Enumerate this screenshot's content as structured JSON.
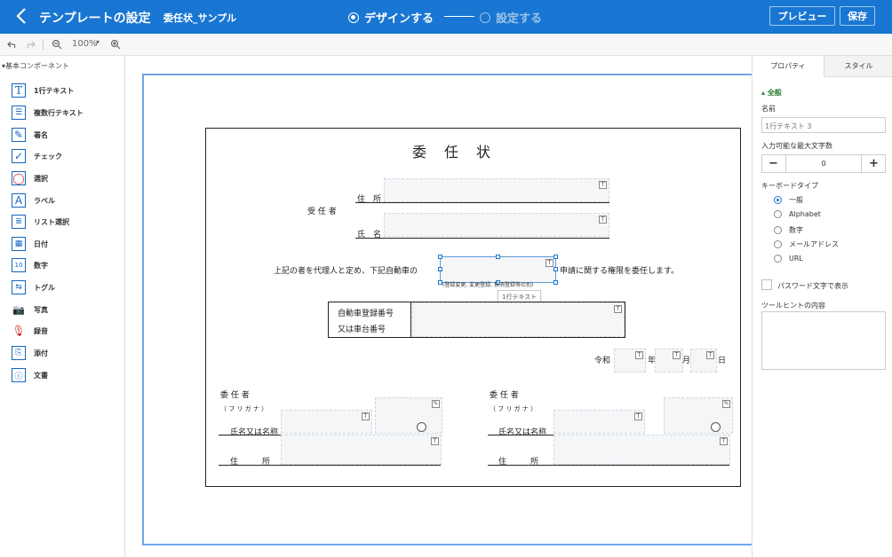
{
  "header": {
    "title": "テンプレートの設定",
    "doc_name": "委任状_サンプル",
    "step_design": "デザインする",
    "step_settings": "設定する",
    "preview_label": "プレビュー",
    "save_label": "保存"
  },
  "toolbar": {
    "zoom": "100%"
  },
  "left_panel": {
    "heading": "基本コンポーネント",
    "items": [
      {
        "label": "1行テキスト",
        "icon": "text-icon"
      },
      {
        "label": "複数行テキスト",
        "icon": "multiline-text-icon"
      },
      {
        "label": "署名",
        "icon": "signature-icon"
      },
      {
        "label": "チェック",
        "icon": "check-icon"
      },
      {
        "label": "選択",
        "icon": "select-icon"
      },
      {
        "label": "ラベル",
        "icon": "label-icon"
      },
      {
        "label": "リスト選択",
        "icon": "list-icon"
      },
      {
        "label": "日付",
        "icon": "calendar-icon"
      },
      {
        "label": "数字",
        "icon": "number-icon"
      },
      {
        "label": "トグル",
        "icon": "toggle-icon"
      },
      {
        "label": "写真",
        "icon": "camera-icon"
      },
      {
        "label": "録音",
        "icon": "microphone-icon"
      },
      {
        "label": "添付",
        "icon": "attachment-icon"
      },
      {
        "label": "文書",
        "icon": "document-icon"
      }
    ]
  },
  "document": {
    "title": "委　任　状",
    "delegator": "受 任 者",
    "address": "住　所",
    "name": "氏　名",
    "sentence_a": "上記の者を代理人と定め、下記自動車の",
    "sentence_b": "申請に関する権限を委任します。",
    "field_hint": "(登録変更, 変更登録, 抹消登録等の別)",
    "tooltip": "1行テキスト",
    "reg_no_1": "自動車登録番号",
    "reg_no_2": "又は車台番号",
    "era": "令和",
    "year": "年",
    "month": "月",
    "day": "日",
    "principal": "委 任 者",
    "furigana": "（ フ リ ガ ナ ）",
    "name_or_company": "氏名又は名称",
    "address2": "住　　　所"
  },
  "right_panel": {
    "tab_properties": "プロパティ",
    "tab_style": "スタイル",
    "section": "全般",
    "name_label": "名前",
    "name_value": "1行テキスト 3",
    "maxlen_label": "入力可能な最大文字数",
    "maxlen_value": "0",
    "keyboard_label": "キーボードタイプ",
    "keyboard_options": [
      "一般",
      "Alphabet",
      "数字",
      "メールアドレス",
      "URL"
    ],
    "password_label": "パスワード文字で表示",
    "tooltip_label": "ツールヒントの内容"
  },
  "colors": {
    "header": "#1976d2",
    "selection": "#5b9bd5"
  }
}
